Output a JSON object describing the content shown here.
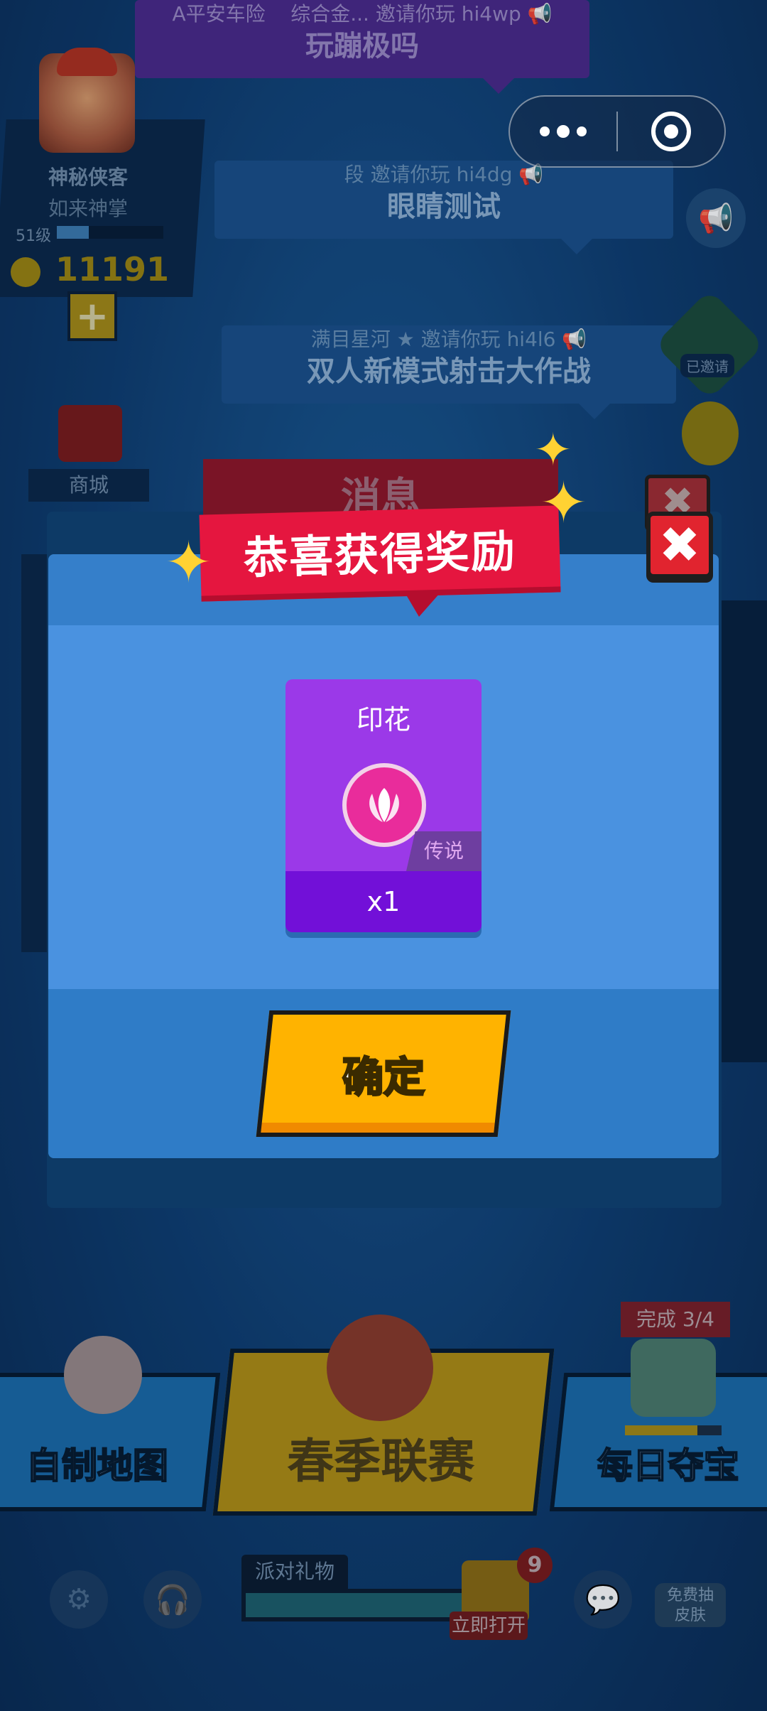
{
  "invites": [
    {
      "from": "A平安车险",
      "from2": "综合金...",
      "action": "邀请你玩",
      "code": "hi4wp",
      "game": "玩蹦极吗"
    },
    {
      "from": "段",
      "action": "邀请你玩",
      "code": "hi4dg",
      "game": "眼睛测试"
    },
    {
      "from": "满目星河",
      "action": "邀请你玩",
      "code": "hi4l6",
      "game": "双人新模式射击大作战"
    }
  ],
  "profile": {
    "name": "神秘侠客",
    "subtitle": "如来神掌",
    "level": "51级",
    "level_progress": 0.3,
    "coins": "11191"
  },
  "shop": {
    "label": "商城"
  },
  "side": {
    "joined_label": "已邀请"
  },
  "background_window": {
    "title": "消息"
  },
  "modal": {
    "title": "恭喜获得奖励",
    "reward": {
      "name": "印花",
      "rarity": "传说",
      "quantity": "x1"
    },
    "confirm_label": "确定",
    "close_icon": "close-icon"
  },
  "modes": {
    "left": "自制地图",
    "center": "春季联赛",
    "right": "每日夺宝"
  },
  "daily": {
    "complete_label": "完成 3/4",
    "progress": 0.75
  },
  "gift": {
    "label": "派对礼物",
    "count": "9",
    "open_label": "立即打开"
  },
  "free_skin": {
    "line1": "免费抽",
    "line2": "皮肤"
  },
  "colors": {
    "banner_red": "#e5163f",
    "modal_blue": "#4a92e0",
    "card_purple": "#9b39e8",
    "confirm_yellow": "#ffb300",
    "close_red": "#e1242f"
  }
}
